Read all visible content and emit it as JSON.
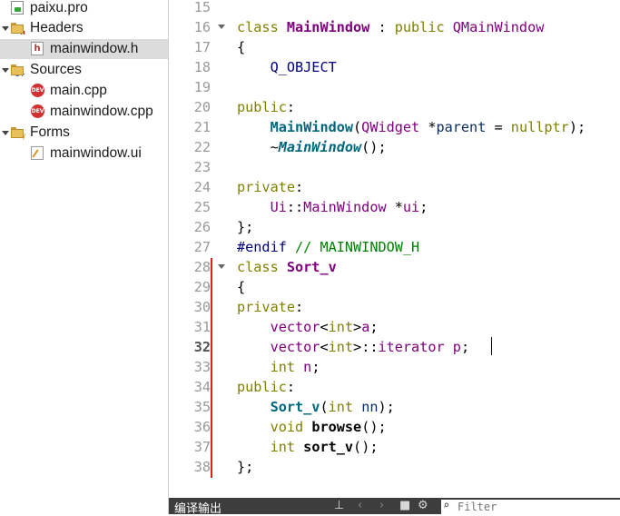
{
  "project_tree": {
    "items": [
      {
        "label": "paixu.pro",
        "icon": "pro-file-icon"
      },
      {
        "label": "Headers",
        "icon": "folder-icon"
      },
      {
        "label": "mainwindow.h",
        "icon": "header-file-icon"
      },
      {
        "label": "Sources",
        "icon": "folder-icon"
      },
      {
        "label": "main.cpp",
        "icon": "cpp-file-icon"
      },
      {
        "label": "mainwindow.cpp",
        "icon": "cpp-file-icon"
      },
      {
        "label": "Forms",
        "icon": "folder-icon"
      },
      {
        "label": "mainwindow.ui",
        "icon": "ui-file-icon"
      }
    ],
    "selected": "mainwindow.h"
  },
  "editor": {
    "current_line": "32",
    "lines": [
      {
        "n": "15",
        "text": ""
      },
      {
        "n": "16",
        "text": "class MainWindow : public QMainWindow"
      },
      {
        "n": "17",
        "text": "{"
      },
      {
        "n": "18",
        "text": "    Q_OBJECT"
      },
      {
        "n": "19",
        "text": ""
      },
      {
        "n": "20",
        "text": "public:"
      },
      {
        "n": "21",
        "text": "    MainWindow(QWidget *parent = nullptr);"
      },
      {
        "n": "22",
        "text": "    ~MainWindow();"
      },
      {
        "n": "23",
        "text": ""
      },
      {
        "n": "24",
        "text": "private:"
      },
      {
        "n": "25",
        "text": "    Ui::MainWindow *ui;"
      },
      {
        "n": "26",
        "text": "};"
      },
      {
        "n": "27",
        "text": "#endif // MAINWINDOW_H"
      },
      {
        "n": "28",
        "text": "class Sort_v"
      },
      {
        "n": "29",
        "text": "{"
      },
      {
        "n": "30",
        "text": "private:"
      },
      {
        "n": "31",
        "text": "    vector<int>a;"
      },
      {
        "n": "32",
        "text": "    vector<int>::iterator p;"
      },
      {
        "n": "33",
        "text": "    int n;"
      },
      {
        "n": "34",
        "text": "public:"
      },
      {
        "n": "35",
        "text": "    Sort_v(int nn);"
      },
      {
        "n": "36",
        "text": "    void browse();"
      },
      {
        "n": "37",
        "text": "    int sort_v();"
      },
      {
        "n": "38",
        "text": "};"
      }
    ]
  },
  "bottom_bar": {
    "panel_title": "编译输出",
    "filter_placeholder": "Filter"
  },
  "colors": {
    "keyword": "#808000",
    "type": "#800080",
    "function": "#00677c",
    "comment": "#008000",
    "change_marker": "#e02020",
    "bottom_bar": "#3d3d3d"
  }
}
